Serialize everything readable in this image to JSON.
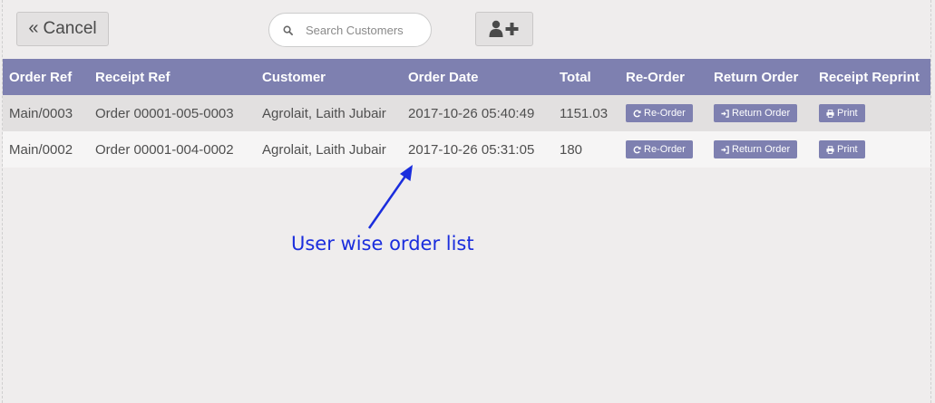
{
  "toolbar": {
    "cancel_label": "Cancel",
    "cancel_icon": "double-chevron-left-icon",
    "search_placeholder": "Search Customers",
    "search_icon": "search-icon",
    "add_customer_icon": "user-plus-icon"
  },
  "table": {
    "columns": [
      "Order Ref",
      "Receipt Ref",
      "Customer",
      "Order Date",
      "Total",
      "Re-Order",
      "Return Order",
      "Receipt Reprint"
    ],
    "rows": [
      {
        "order_ref": "Main/0003",
        "receipt_ref": "Order 00001-005-0003",
        "customer": "Agrolait, Laith Jubair",
        "order_date": "2017-10-26 05:40:49",
        "total": "1151.03",
        "reorder_label": "Re-Order",
        "return_label": "Return Order",
        "print_label": "Print"
      },
      {
        "order_ref": "Main/0002",
        "receipt_ref": "Order 00001-004-0002",
        "customer": "Agrolait, Laith Jubair",
        "order_date": "2017-10-26 05:31:05",
        "total": "180",
        "reorder_label": "Re-Order",
        "return_label": "Return Order",
        "print_label": "Print"
      }
    ]
  },
  "annotation": {
    "text": "User wise order list",
    "color": "#1a2ddd"
  },
  "colors": {
    "header_bg": "#7e80b0",
    "button_bg": "#7e80b0",
    "page_bg": "#efeded"
  }
}
